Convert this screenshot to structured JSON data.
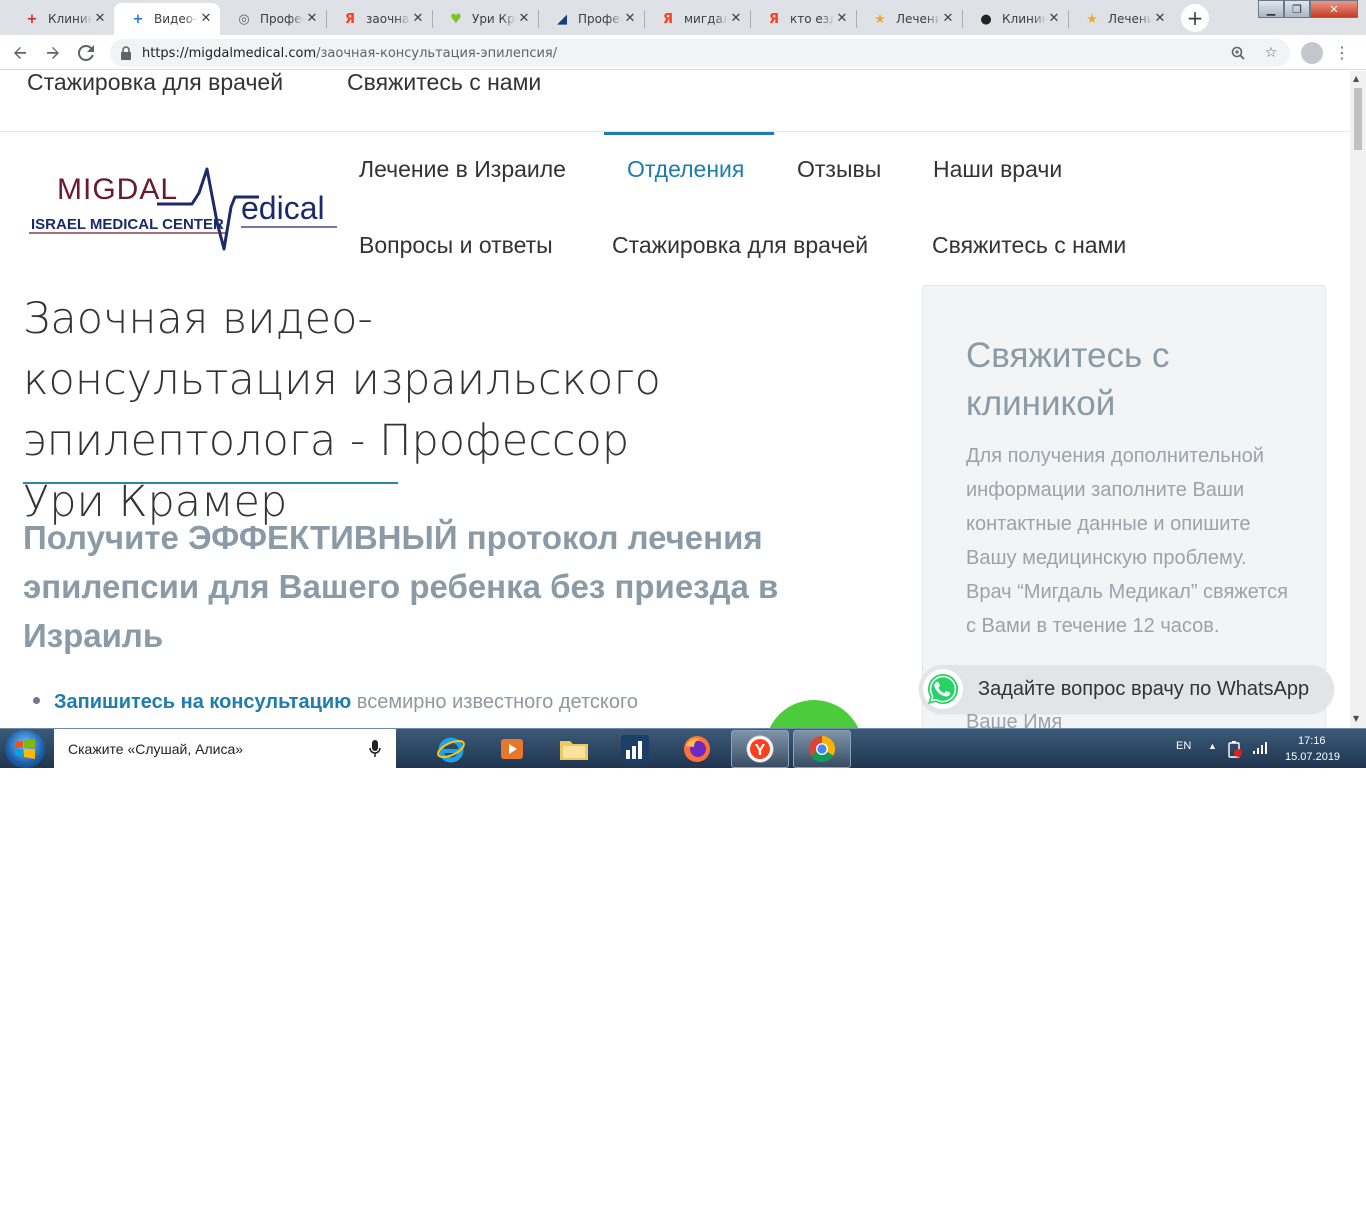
{
  "browser": {
    "tabs": [
      {
        "title": "Клиника",
        "fav": "+",
        "fav_color": "#e02020"
      },
      {
        "title": "Видео-консультация",
        "fav": "+",
        "fav_color": "#1a73e8",
        "active": true
      },
      {
        "title": "Профессор",
        "fav": "◎",
        "fav_color": "#5f6368"
      },
      {
        "title": "заочная",
        "fav": "Я",
        "fav_color": "#fc3f1d"
      },
      {
        "title": "Ури Крамер",
        "fav": "♥",
        "fav_color": "#7cc520"
      },
      {
        "title": "Профессор",
        "fav": "◢",
        "fav_color": "#123e7a"
      },
      {
        "title": "мигдаль",
        "fav": "Я",
        "fav_color": "#fc3f1d"
      },
      {
        "title": "кто ездил",
        "fav": "Я",
        "fav_color": "#fc3f1d"
      },
      {
        "title": "Лечение",
        "fav": "★",
        "fav_color": "#f2a72b"
      },
      {
        "title": "Клиника",
        "fav": "●",
        "fav_color": "#222222"
      },
      {
        "title": "Лечение",
        "fav": "★",
        "fav_color": "#f2a72b"
      }
    ],
    "url_host": "https://migdalmedical.com",
    "url_path": "/заочная-консультация-эпилепсия/"
  },
  "page": {
    "top_nav": [
      "Стажировка для врачей",
      "Свяжитесь с нами"
    ],
    "logo": {
      "word_left": "MIGDAL",
      "word_right": "edical",
      "tagline": "ISRAEL MEDICAL CENTER"
    },
    "main_nav": [
      "Лечение в Израиле",
      "Отделения",
      "Отзывы",
      "Наши врачи",
      "Вопросы и ответы",
      "Стажировка для врачей",
      "Свяжитесь с нами"
    ],
    "active_nav": "Отделения",
    "title": "Заочная видео-консультация израильского эпилептолога - Профессор Ури Крамер",
    "subtitle": "Получите ЭФФЕКТИВНЫЙ протокол лечения эпилепсии для Вашего ребенка без приезда в Израиль",
    "bullet_strong": "Запишитесь на консультацию",
    "bullet_rest": " всемирно известного детского",
    "sidebar": {
      "title": "Свяжитесь с клиникой",
      "text": "Для получения дополнительной информации заполните Ваши контактные данные и опишите Вашу медицинскую проблему. Врач “Мигдаль Медикал” свяжется с Вами в течение 12 часов.",
      "field_label": "Ваше Имя"
    },
    "whatsapp_label": "Задайте вопрос врачу по WhatsApp"
  },
  "taskbar": {
    "search_text": "Скажите «Слушай, Алиса»",
    "lang": "EN",
    "time": "17:16",
    "date": "15.07.2019"
  },
  "colors": {
    "accent": "#1e7cae",
    "logo_text": "#6b1a2c",
    "logo_navy": "#1b2a6b",
    "whatsapp_green": "#25d366"
  }
}
